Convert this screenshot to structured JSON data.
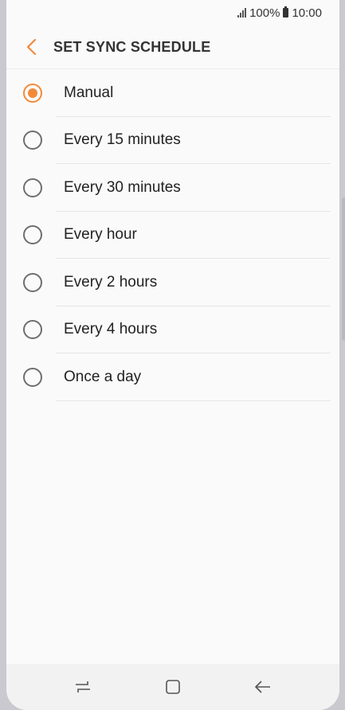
{
  "status_bar": {
    "battery": "100%",
    "time": "10:00"
  },
  "header": {
    "title": "SET SYNC SCHEDULE",
    "back_icon": "chevron-left-icon"
  },
  "colors": {
    "accent": "#f28a3a",
    "background": "#fafafa",
    "frame": "#c9c9cf"
  },
  "sync_options": {
    "selected": "Manual",
    "items": [
      {
        "label": "Manual",
        "checked": true
      },
      {
        "label": "Every 15 minutes",
        "checked": false
      },
      {
        "label": "Every 30 minutes",
        "checked": false
      },
      {
        "label": "Every hour",
        "checked": false
      },
      {
        "label": "Every 2 hours",
        "checked": false
      },
      {
        "label": "Every 4 hours",
        "checked": false
      },
      {
        "label": "Once a day",
        "checked": false
      }
    ]
  },
  "nav_bar": {
    "icons": [
      "recent-apps-icon",
      "home-icon",
      "back-icon"
    ]
  }
}
